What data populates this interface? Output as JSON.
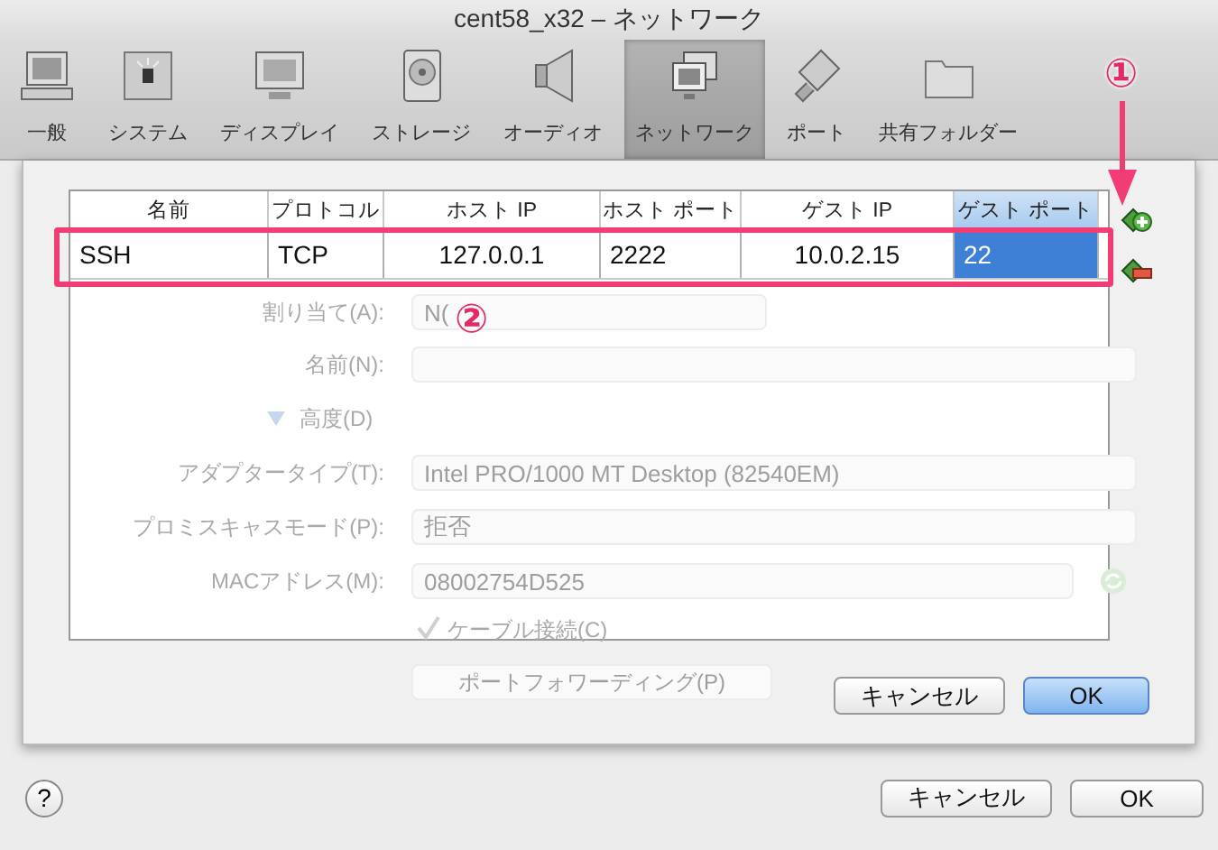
{
  "window": {
    "title": "cent58_x32 – ネットワーク"
  },
  "toolbar": [
    {
      "label": "一般",
      "selected": false
    },
    {
      "label": "システム",
      "selected": false
    },
    {
      "label": "ディスプレイ",
      "selected": false
    },
    {
      "label": "ストレージ",
      "selected": false
    },
    {
      "label": "オーディオ",
      "selected": false
    },
    {
      "label": "ネットワーク",
      "selected": true
    },
    {
      "label": "ポート",
      "selected": false
    },
    {
      "label": "共有フォルダー",
      "selected": false
    }
  ],
  "background_form": [
    {
      "kind": "select",
      "label": "割り当て(A):",
      "value": "N("
    },
    {
      "kind": "select",
      "label": "名前(N):"
    },
    {
      "kind": "disclosure",
      "label": "高度(D)"
    },
    {
      "kind": "select",
      "label": "アダプタータイプ(T):",
      "value": "Intel PRO/1000 MT Desktop (82540EM)"
    },
    {
      "kind": "select",
      "label": "プロミスキャスモード(P):",
      "value": "拒否"
    },
    {
      "kind": "input",
      "label": "MACアドレス(M):",
      "value": "08002754D525"
    },
    {
      "kind": "checkbox",
      "label": "ケーブル接続(C)",
      "checked": true
    },
    {
      "kind": "button",
      "label": "ポートフォワーディング(P)"
    }
  ],
  "port_forwarding": {
    "columns": [
      {
        "label": "名前",
        "selected": false
      },
      {
        "label": "プロトコル",
        "selected": false
      },
      {
        "label": "ホスト IP",
        "selected": false
      },
      {
        "label": "ホスト ポート",
        "selected": false
      },
      {
        "label": "ゲスト IP",
        "selected": false
      },
      {
        "label": "ゲスト ポート",
        "selected": true
      }
    ],
    "rows": [
      {
        "cells": [
          {
            "text": "SSH",
            "selected": false
          },
          {
            "text": "TCP",
            "selected": false
          },
          {
            "text": "127.0.0.1",
            "selected": false
          },
          {
            "text": "2222",
            "selected": false
          },
          {
            "text": "10.0.2.15",
            "selected": false
          },
          {
            "text": "22",
            "selected": true
          }
        ]
      }
    ],
    "buttons": [
      {
        "label": "キャンセル",
        "default": false
      },
      {
        "label": "OK",
        "default": true
      }
    ]
  },
  "annotations": [
    {
      "label": "①"
    },
    {
      "label": "②"
    }
  ],
  "help": {
    "label": "?"
  },
  "buttons": [
    {
      "label": "キャンセル",
      "default": false
    },
    {
      "label": "OK",
      "default": false
    }
  ]
}
